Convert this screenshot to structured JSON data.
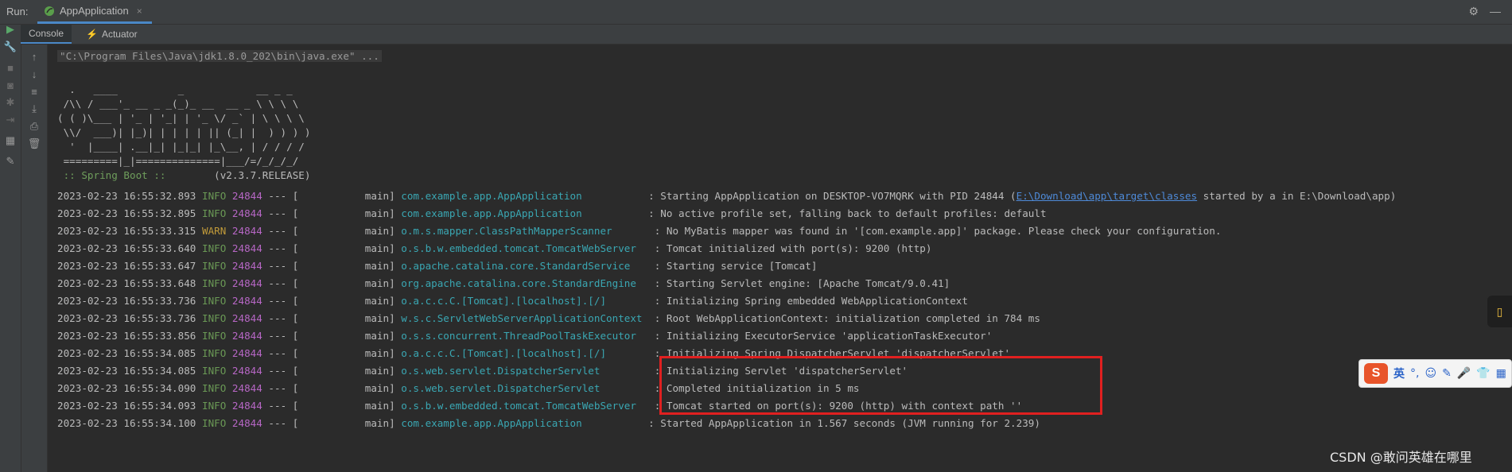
{
  "header": {
    "run_label": "Run:",
    "tab_title": "AppApplication",
    "tab_close": "×",
    "settings_icon": "⚙",
    "minimize_icon": "—"
  },
  "subtabs": {
    "console": "Console",
    "actuator": "Actuator"
  },
  "console": {
    "command": "\"C:\\Program Files\\Java\\jdk1.8.0_202\\bin\\java.exe\" ...",
    "banner": [
      "  .   ____          _            __ _ _",
      " /\\\\ / ___'_ __ _ _(_)_ __  __ _ \\ \\ \\ \\",
      "( ( )\\___ | '_ | '_| | '_ \\/ _` | \\ \\ \\ \\",
      " \\\\/  ___)| |_)| | | | | || (_| |  ) ) ) )",
      "  '  |____| .__|_| |_|_| |_\\__, | / / / /",
      " =========|_|==============|___/=/_/_/_/"
    ],
    "spring_label": " :: Spring Boot :: ",
    "spring_version": "       (v2.3.7.RELEASE)",
    "logs": [
      {
        "ts": "2023-02-23 16:55:32.893",
        "level": "INFO",
        "pid": "24844",
        "sep": " --- [           main] ",
        "cls": "com.example.app.AppApplication          ",
        "msg": " : Starting AppApplication on DESKTOP-VO7MQRK with PID 24844 (",
        "link": "E:\\Download\\app\\target\\classes",
        "tail": " started by a in E:\\Download\\app)"
      },
      {
        "ts": "2023-02-23 16:55:32.895",
        "level": "INFO",
        "pid": "24844",
        "sep": " --- [           main] ",
        "cls": "com.example.app.AppApplication          ",
        "msg": " : No active profile set, falling back to default profiles: default",
        "link": "",
        "tail": ""
      },
      {
        "ts": "2023-02-23 16:55:33.315",
        "level": "WARN",
        "pid": "24844",
        "sep": " --- [           main] ",
        "cls": "o.m.s.mapper.ClassPathMapperScanner      ",
        "msg": " : No MyBatis mapper was found in '[com.example.app]' package. Please check your configuration.",
        "link": "",
        "tail": ""
      },
      {
        "ts": "2023-02-23 16:55:33.640",
        "level": "INFO",
        "pid": "24844",
        "sep": " --- [           main] ",
        "cls": "o.s.b.w.embedded.tomcat.TomcatWebServer  ",
        "msg": " : Tomcat initialized with port(s): 9200 (http)",
        "link": "",
        "tail": ""
      },
      {
        "ts": "2023-02-23 16:55:33.647",
        "level": "INFO",
        "pid": "24844",
        "sep": " --- [           main] ",
        "cls": "o.apache.catalina.core.StandardService   ",
        "msg": " : Starting service [Tomcat]",
        "link": "",
        "tail": ""
      },
      {
        "ts": "2023-02-23 16:55:33.648",
        "level": "INFO",
        "pid": "24844",
        "sep": " --- [           main] ",
        "cls": "org.apache.catalina.core.StandardEngine  ",
        "msg": " : Starting Servlet engine: [Apache Tomcat/9.0.41]",
        "link": "",
        "tail": ""
      },
      {
        "ts": "2023-02-23 16:55:33.736",
        "level": "INFO",
        "pid": "24844",
        "sep": " --- [           main] ",
        "cls": "o.a.c.c.C.[Tomcat].[localhost].[/]       ",
        "msg": " : Initializing Spring embedded WebApplicationContext",
        "link": "",
        "tail": ""
      },
      {
        "ts": "2023-02-23 16:55:33.736",
        "level": "INFO",
        "pid": "24844",
        "sep": " --- [           main] ",
        "cls": "w.s.c.ServletWebServerApplicationContext ",
        "msg": " : Root WebApplicationContext: initialization completed in 784 ms",
        "link": "",
        "tail": ""
      },
      {
        "ts": "2023-02-23 16:55:33.856",
        "level": "INFO",
        "pid": "24844",
        "sep": " --- [           main] ",
        "cls": "o.s.s.concurrent.ThreadPoolTaskExecutor  ",
        "msg": " : Initializing ExecutorService 'applicationTaskExecutor'",
        "link": "",
        "tail": ""
      },
      {
        "ts": "2023-02-23 16:55:34.085",
        "level": "INFO",
        "pid": "24844",
        "sep": " --- [           main] ",
        "cls": "o.a.c.c.C.[Tomcat].[localhost].[/]       ",
        "msg": " : Initializing Spring DispatcherServlet 'dispatcherServlet'",
        "link": "",
        "tail": ""
      },
      {
        "ts": "2023-02-23 16:55:34.085",
        "level": "INFO",
        "pid": "24844",
        "sep": " --- [           main] ",
        "cls": "o.s.web.servlet.DispatcherServlet        ",
        "msg": " : Initializing Servlet 'dispatcherServlet'",
        "link": "",
        "tail": ""
      },
      {
        "ts": "2023-02-23 16:55:34.090",
        "level": "INFO",
        "pid": "24844",
        "sep": " --- [           main] ",
        "cls": "o.s.web.servlet.DispatcherServlet        ",
        "msg": " : Completed initialization in 5 ms",
        "link": "",
        "tail": ""
      },
      {
        "ts": "2023-02-23 16:55:34.093",
        "level": "INFO",
        "pid": "24844",
        "sep": " --- [           main] ",
        "cls": "o.s.b.w.embedded.tomcat.TomcatWebServer  ",
        "msg": " : Tomcat started on port(s): 9200 (http) with context path ''",
        "link": "",
        "tail": ""
      },
      {
        "ts": "2023-02-23 16:55:34.100",
        "level": "INFO",
        "pid": "24844",
        "sep": " --- [           main] ",
        "cls": "com.example.app.AppApplication          ",
        "msg": " : Started AppApplication in 1.567 seconds (JVM running for 2.239)",
        "link": "",
        "tail": ""
      }
    ]
  },
  "ime": {
    "logo": "S",
    "lang": "英"
  },
  "watermark": "CSDN @敢问英雄在哪里",
  "colors": {
    "info": "#6a9955",
    "warn": "#c19a3a",
    "pid": "#b767c5",
    "class": "#3aa7b3",
    "highlight_box": "#e02020"
  }
}
